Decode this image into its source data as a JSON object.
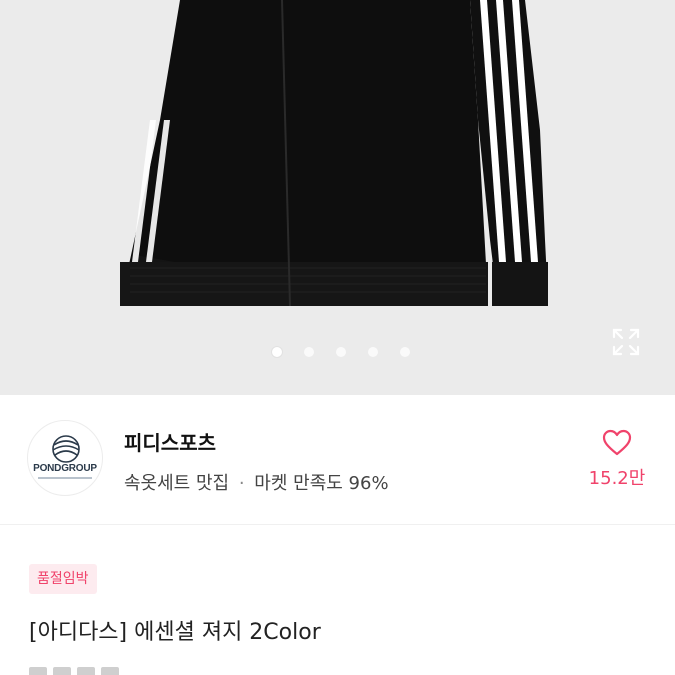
{
  "gallery": {
    "image_subject": "black jacket with three white stripes",
    "slide_count": 5,
    "active_slide": 1,
    "expand_icon": "expand-icon"
  },
  "shop": {
    "name": "피디스포츠",
    "logo_text": "PONDGROUP",
    "tagline": "속옷세트 맛집",
    "separator": "·",
    "satisfaction": "마켓 만족도 96%",
    "like_icon": "heart-icon",
    "like_count": "15.2만"
  },
  "product": {
    "badge": "품절임박",
    "title": "[아디다스] 에센셜 져지 2Color"
  },
  "colors": {
    "accent": "#f0436b",
    "hero_bg": "#ebebeb",
    "jacket": "#0d0d0d"
  }
}
